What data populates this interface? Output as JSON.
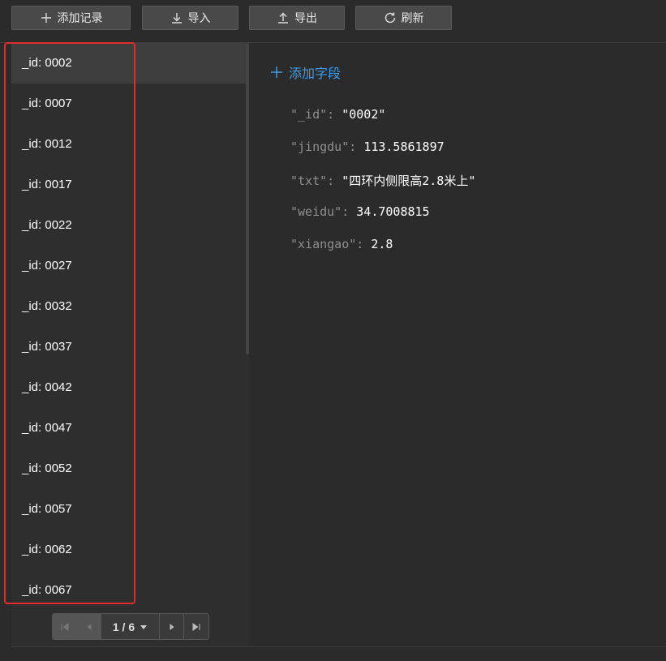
{
  "toolbar": {
    "add_record": "添加记录",
    "import": "导入",
    "export": "导出",
    "refresh": "刷新"
  },
  "records": [
    {
      "label": "_id: 0002"
    },
    {
      "label": "_id: 0007"
    },
    {
      "label": "_id: 0012"
    },
    {
      "label": "_id: 0017"
    },
    {
      "label": "_id: 0022"
    },
    {
      "label": "_id: 0027"
    },
    {
      "label": "_id: 0032"
    },
    {
      "label": "_id: 0037"
    },
    {
      "label": "_id: 0042"
    },
    {
      "label": "_id: 0047"
    },
    {
      "label": "_id: 0052"
    },
    {
      "label": "_id: 0057"
    },
    {
      "label": "_id: 0062"
    },
    {
      "label": "_id: 0067"
    }
  ],
  "selected_index": 0,
  "pagination": {
    "page_info": "1 / 6"
  },
  "detail": {
    "add_field": "添加字段",
    "fields": [
      {
        "key": "\"_id\"",
        "value": "\"0002\""
      },
      {
        "key": "\"jingdu\"",
        "value": "113.5861897"
      },
      {
        "key": "\"txt\"",
        "value": "\"四环内侧限高2.8米上\""
      },
      {
        "key": "\"weidu\"",
        "value": "34.7008815"
      },
      {
        "key": "\"xiangao\"",
        "value": "2.8"
      }
    ]
  },
  "colors": {
    "accent": "#3d9be9",
    "highlight_box": "#e02b2b",
    "background": "#2b2b2b"
  }
}
